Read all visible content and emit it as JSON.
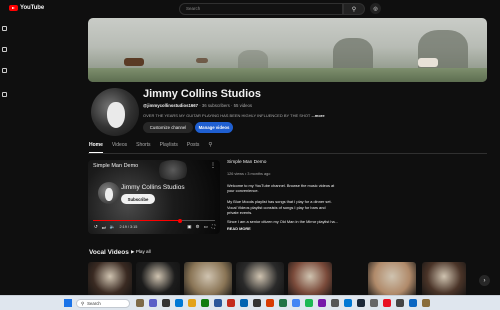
{
  "header": {
    "logo_text": "YouTube",
    "search_placeholder": "Search",
    "search_icon": "search-icon",
    "mic_icon": "mic-icon"
  },
  "rail": {
    "items": [
      {
        "label": "",
        "icon": "home-icon"
      },
      {
        "label": "",
        "icon": "shorts-icon"
      },
      {
        "label": "",
        "icon": "subscriptions-icon"
      },
      {
        "label": "",
        "icon": "library-icon"
      }
    ]
  },
  "channel": {
    "name": "Jimmy Collins Studios",
    "handle": "@jimmycollinsstudios1667",
    "subscribers": "36 subscribers",
    "videos": "55 videos",
    "description": "OVER THE YEARS MY GUITAR PLAYING HAS BEEN HIGHLY INFLUENCED BY THE SHOT",
    "more_label": "...more",
    "customize_label": "Customize channel",
    "manage_label": "Manage videos"
  },
  "tabs": [
    {
      "label": "Home",
      "active": true
    },
    {
      "label": "Videos",
      "active": false
    },
    {
      "label": "Shorts",
      "active": false
    },
    {
      "label": "Playlists",
      "active": false
    },
    {
      "label": "Posts",
      "active": false
    }
  ],
  "featured": {
    "player_title": "Simple Man Demo",
    "overlay_channel": "Jimmy Collins Studios",
    "subscribe_label": "Subscribe",
    "time": "2:19 / 3:15",
    "progress": 0.71,
    "title": "Simple Man Demo",
    "stats": "126 views • 3 months ago",
    "lines": [
      "Welcome to my YouTube channel.  Browse the music videos at",
      "your convenience.",
      "",
      "My Blue Moods playlist has songs that I play for a dinner set.",
      "Vocal Videos playlist consists of songs I play for bars and",
      "private events.",
      "Since I am a senior citizen my Old Man in the Mirror playlist ha..."
    ],
    "read_more": "READ MORE"
  },
  "shelf": {
    "title": "Vocal Videos",
    "play_all": "Play all",
    "thumb_colors": [
      "#3a2a22",
      "#1c1c1c",
      "#8a7556",
      "#2a2a2a",
      "#7a4a3a",
      "#b08a6a",
      "#4a3428"
    ]
  },
  "taskbar": {
    "search_label": "Search"
  }
}
